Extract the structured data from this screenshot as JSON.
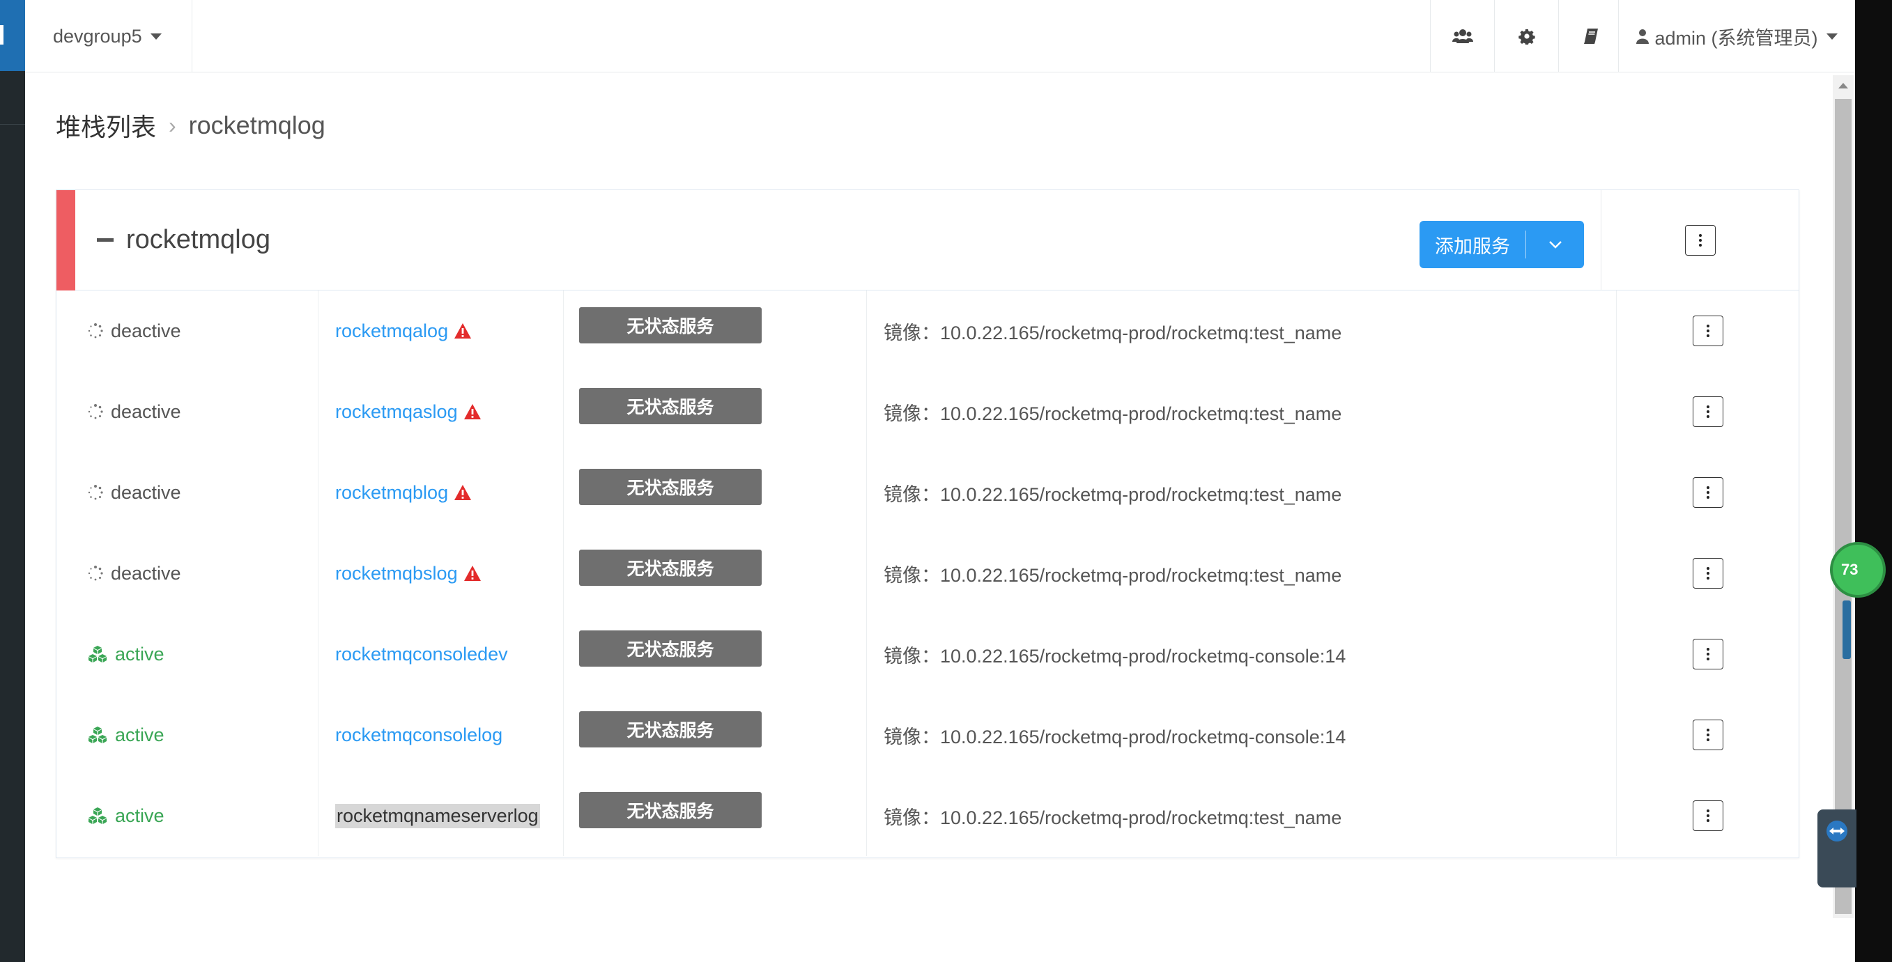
{
  "topbar": {
    "group": "devgroup5",
    "user": "admin (系统管理员)"
  },
  "breadcrumb": {
    "root": "堆栈列表",
    "separator": "›",
    "current": "rocketmqlog"
  },
  "stack": {
    "name": "rocketmqlog",
    "add_service_label": "添加服务",
    "accent_color": "#ee5d62",
    "button_color": "#2b9af3"
  },
  "services": [
    {
      "status": "deactive",
      "name": "rocketmqalog",
      "warning": true,
      "type": "无状态服务",
      "image": "镜像：10.0.22.165/rocketmq-prod/rocketmq:test_name"
    },
    {
      "status": "deactive",
      "name": "rocketmqaslog",
      "warning": true,
      "type": "无状态服务",
      "image": "镜像：10.0.22.165/rocketmq-prod/rocketmq:test_name"
    },
    {
      "status": "deactive",
      "name": "rocketmqblog",
      "warning": true,
      "type": "无状态服务",
      "image": "镜像：10.0.22.165/rocketmq-prod/rocketmq:test_name"
    },
    {
      "status": "deactive",
      "name": "rocketmqbslog",
      "warning": true,
      "type": "无状态服务",
      "image": "镜像：10.0.22.165/rocketmq-prod/rocketmq:test_name"
    },
    {
      "status": "active",
      "name": "rocketmqconsoledev",
      "warning": false,
      "type": "无状态服务",
      "image": "镜像：10.0.22.165/rocketmq-prod/rocketmq-console:14"
    },
    {
      "status": "active",
      "name": "rocketmqconsolelog",
      "warning": false,
      "type": "无状态服务",
      "image": "镜像：10.0.22.165/rocketmq-prod/rocketmq-console:14"
    },
    {
      "status": "active",
      "name": "rocketmqnameserverlog",
      "warning": false,
      "type": "无状态服务",
      "image": "镜像：10.0.22.165/rocketmq-prod/rocketmq:test_name"
    }
  ],
  "float_badge": "73",
  "icons": [
    "users-icon",
    "gear-icon",
    "book-icon",
    "user-icon",
    "spinner-icon",
    "cubes-icon",
    "warning-icon",
    "kebab-icon",
    "chevron-down-icon",
    "minus-icon"
  ]
}
